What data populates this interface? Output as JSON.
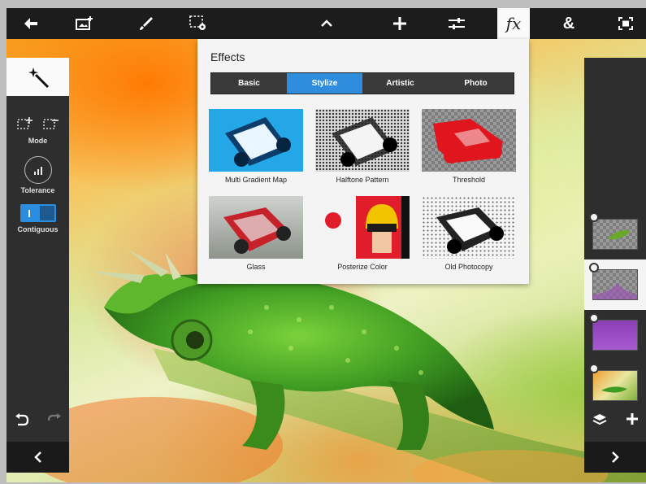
{
  "toolbar": {
    "buttons": [
      {
        "name": "back-arrow-icon",
        "glyph": "←"
      },
      {
        "name": "add-image-icon",
        "glyph": ""
      },
      {
        "name": "brush-icon",
        "glyph": ""
      },
      {
        "name": "selection-settings-icon",
        "glyph": ""
      },
      {
        "name": "chevron-up-icon",
        "glyph": "˄"
      },
      {
        "name": "plus-icon",
        "glyph": "+"
      },
      {
        "name": "adjustments-icon",
        "glyph": ""
      },
      {
        "name": "fx-icon",
        "glyph": "fx"
      },
      {
        "name": "ampersand-icon",
        "glyph": "&"
      },
      {
        "name": "fit-screen-icon",
        "glyph": ""
      }
    ],
    "active": "fx-icon"
  },
  "left_panel": {
    "mode_label": "Mode",
    "tolerance_label": "Tolerance",
    "contiguous_label": "Contiguous",
    "undo_glyph": "↶",
    "redo_glyph": "↷",
    "nav_glyph": "‹"
  },
  "right_panel": {
    "layers": [
      "leaf-layer",
      "purple-gradient-layer",
      "purple-fill-layer",
      "photo-layer"
    ],
    "selected_index": 1,
    "add_glyph": "+",
    "nav_glyph": "›"
  },
  "effects": {
    "title": "Effects",
    "tabs": [
      "Basic",
      "Stylize",
      "Artistic",
      "Photo"
    ],
    "active_tab": "Stylize",
    "items": [
      {
        "label": "Multi Gradient Map"
      },
      {
        "label": "Halftone Pattern"
      },
      {
        "label": "Threshold"
      },
      {
        "label": "Glass"
      },
      {
        "label": "Posterize Color"
      },
      {
        "label": "Old Photocopy"
      }
    ]
  },
  "colors": {
    "accent": "#2e8ddd",
    "toolbar_bg": "#1c1c1c",
    "panel_bg": "#2e2e2e"
  }
}
